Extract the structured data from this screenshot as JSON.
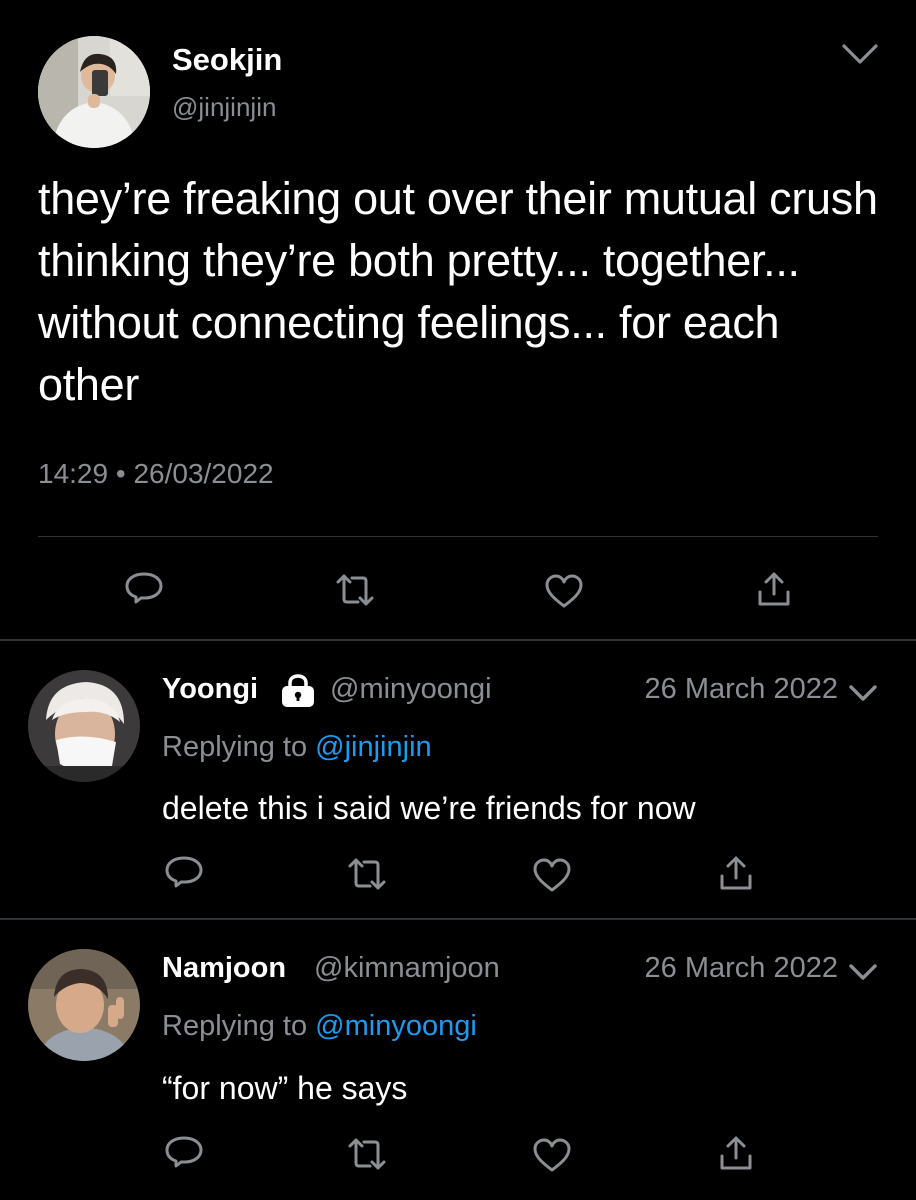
{
  "main_tweet": {
    "display_name": "Seokjin",
    "handle": "@jinjinjin",
    "text": "they’re freaking out over their mutual crush thinking they’re both pretty... together... without connecting feelings... for each other",
    "time": "14:29",
    "separator": "•",
    "date": "26/03/2022"
  },
  "replies": [
    {
      "display_name": "Yoongi",
      "locked": true,
      "handle": "@minyoongi",
      "date": "26 March 2022",
      "replying_prefix": "Replying to",
      "replying_to": "@jinjinjin",
      "text": "delete this i said we’re friends for now"
    },
    {
      "display_name": "Namjoon",
      "locked": false,
      "handle": "@kimnamjoon",
      "date": "26 March 2022",
      "replying_prefix": "Replying to",
      "replying_to": "@minyoongi",
      "text": "“for now” he says"
    }
  ],
  "icons": {
    "reply": "reply-icon",
    "retweet": "retweet-icon",
    "like": "heart-icon",
    "share": "share-icon",
    "more": "chevron-down-icon",
    "lock": "lock-icon"
  },
  "colors": {
    "background": "#000000",
    "text": "#ffffff",
    "secondary": "#8b8f94",
    "link": "#1d9bf0",
    "divider": "#2f3336"
  }
}
